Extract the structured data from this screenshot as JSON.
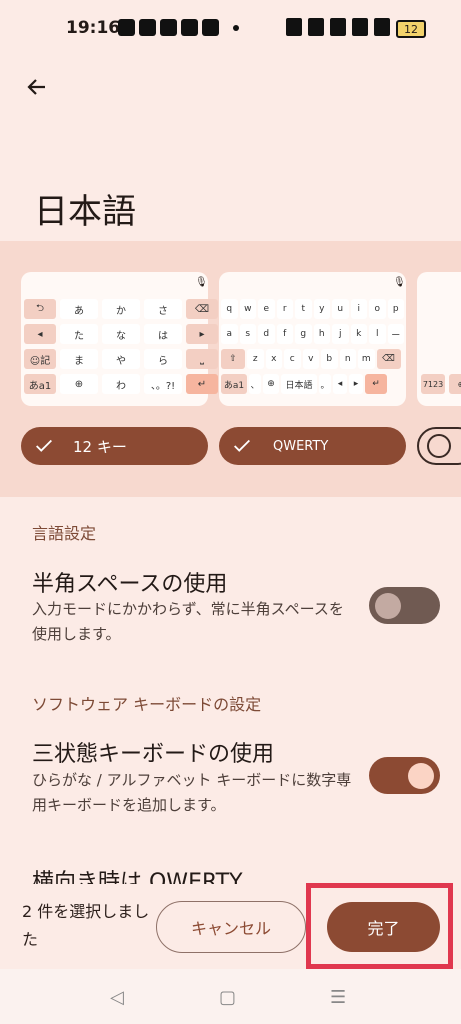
{
  "status": {
    "time": "19:16",
    "battery": "12"
  },
  "page": {
    "title": "日本語"
  },
  "keyboards": {
    "kana_rows": [
      [
        "⮌",
        "あ",
        "か",
        "さ",
        "⌫"
      ],
      [
        "◂",
        "た",
        "な",
        "は",
        "▸"
      ],
      [
        "☺記",
        "ま",
        "や",
        "ら",
        "⎵"
      ],
      [
        "あa1",
        "⊕",
        "わ",
        "、。?!",
        "↵"
      ]
    ],
    "qwerty_rows": [
      [
        "q",
        "w",
        "e",
        "r",
        "t",
        "y",
        "u",
        "i",
        "o",
        "p"
      ],
      [
        "a",
        "s",
        "d",
        "f",
        "g",
        "h",
        "j",
        "k",
        "l",
        "ー"
      ],
      [
        "⇧",
        "z",
        "x",
        "c",
        "v",
        "b",
        "n",
        "m",
        "⌫"
      ],
      [
        "あa1",
        "、",
        "⊕",
        "日本語",
        "。",
        "◂",
        "▸",
        "↵"
      ]
    ],
    "third_keys": [
      "7123",
      "⊕"
    ]
  },
  "chips": [
    {
      "label": "12 キー",
      "selected": true
    },
    {
      "label": "QWERTY",
      "selected": true
    }
  ],
  "sections": {
    "language": "言語設定",
    "software_keyboard": "ソフトウェア キーボードの設定"
  },
  "settings": {
    "halfwidth_space": {
      "title": "半角スペースの使用",
      "summary": "入力モードにかかわらず、常に半角スペースを使用します。",
      "on": false
    },
    "tristate_keyboard": {
      "title": "三状態キーボードの使用",
      "summary": "ひらがな / アルファベット キーボードに数字専用キーボードを追加します。",
      "on": true
    },
    "landscape_qwerty": {
      "title": "横向き時は QWERTY"
    }
  },
  "action_bar": {
    "selection_text": "2 件を選択しました",
    "cancel_label": "キャンセル",
    "done_label": "完了"
  },
  "colors": {
    "accent": "#8c4a33",
    "highlight": "#e0374e",
    "background": "#fcebe6"
  }
}
